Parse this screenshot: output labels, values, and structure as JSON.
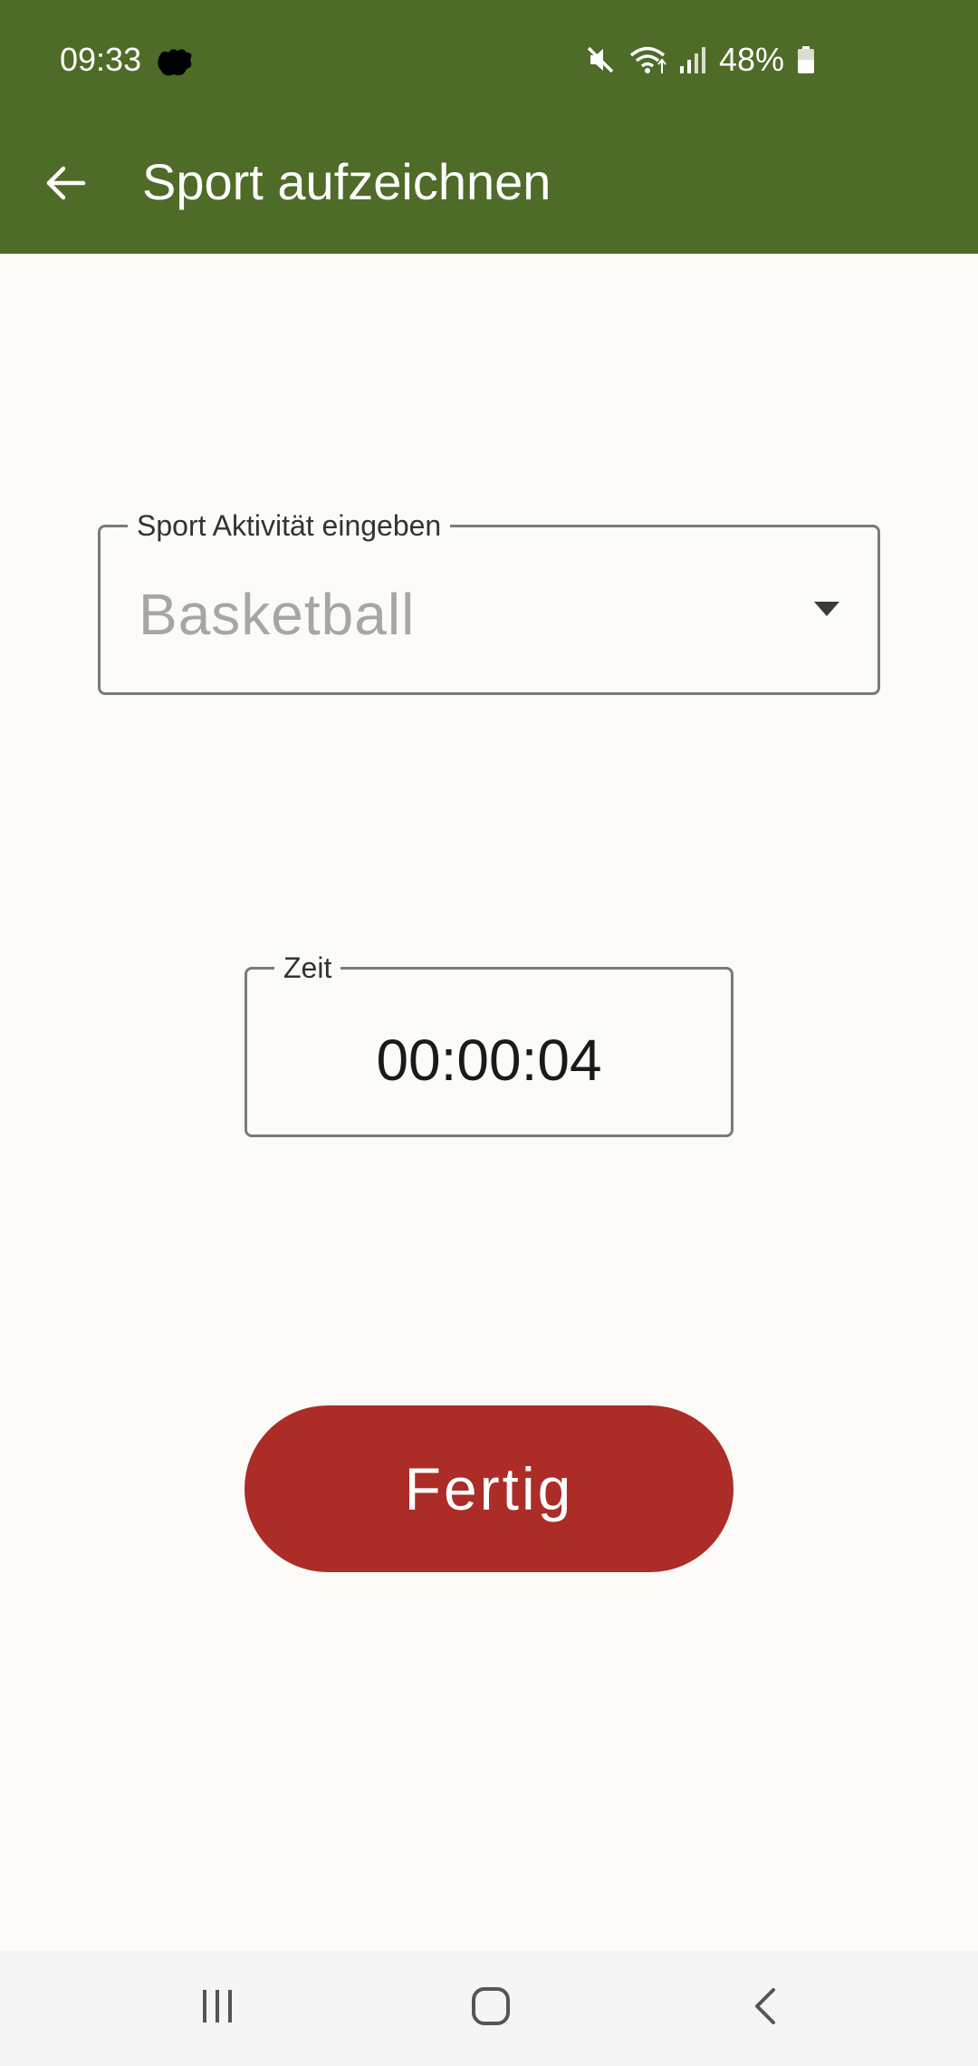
{
  "status_bar": {
    "time": "09:33",
    "battery": "48%"
  },
  "app_bar": {
    "title": "Sport aufzeichnen"
  },
  "activity_field": {
    "label": "Sport Aktivität eingeben",
    "value": "Basketball"
  },
  "time_field": {
    "label": "Zeit",
    "value": "00:00:04"
  },
  "done_button": {
    "label": "Fertig"
  },
  "colors": {
    "app_bar": "#4E6B27",
    "background": "#FCFBF7",
    "button": "#AC2C27"
  },
  "icons": {
    "back": "arrow-left-icon",
    "dropdown": "triangle-down-icon",
    "mute": "mute-icon",
    "wifi": "wifi-icon",
    "signal": "signal-icon",
    "battery": "battery-icon",
    "nav_recents": "recents-icon",
    "nav_home": "home-icon",
    "nav_back": "chevron-left-icon"
  }
}
